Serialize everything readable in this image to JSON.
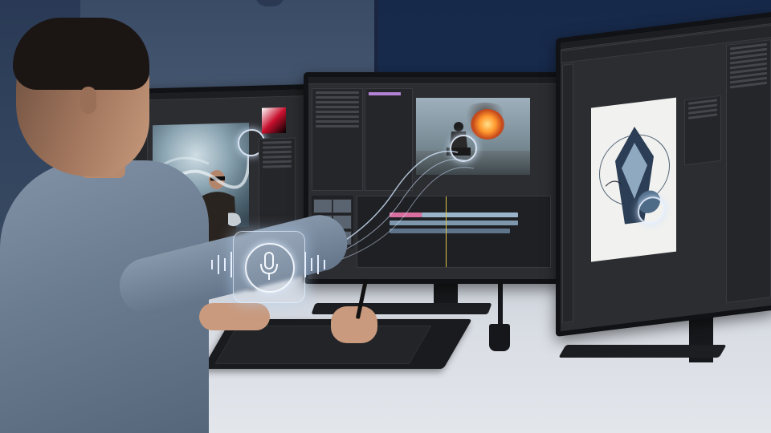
{
  "scene": {
    "description_icons": [
      "microphone-icon",
      "scissors-icon",
      "magic-cursor-icon",
      "sparkle-icon"
    ],
    "colors": {
      "wall": "#1a2e52",
      "desk": "#dfe2e7",
      "glow": "#dbe8f7",
      "timeline_playhead": "#e0c24a",
      "timeline_clip": "#9bb3c9",
      "timeline_pink": "#d86fa0"
    }
  }
}
